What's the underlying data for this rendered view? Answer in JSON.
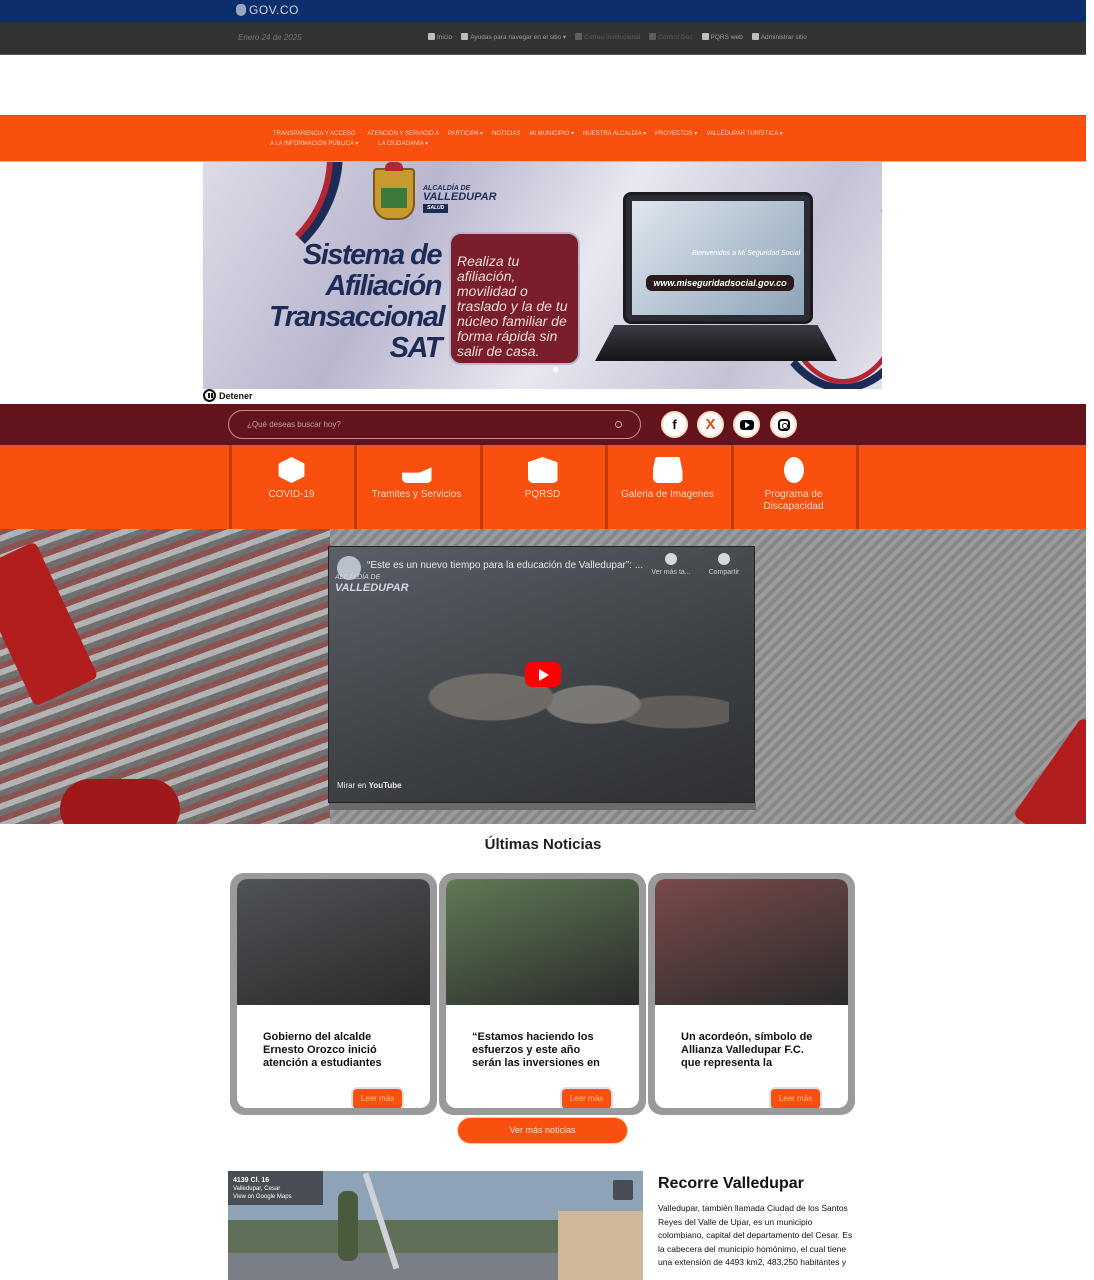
{
  "gov_bar": {
    "logo_text": "GOV.CO"
  },
  "utility_bar": {
    "date": "Enero 24 de 2025",
    "links": [
      {
        "label": "Inicio",
        "icon": "home-icon"
      },
      {
        "label": "Ayudas para navegar en el sitio ▾",
        "icon": "info-icon"
      },
      {
        "label": "Correo Institucional",
        "icon": "mail-icon"
      },
      {
        "label": "Control Doc",
        "icon": "folder-icon"
      },
      {
        "label": "PQRS web",
        "icon": "megaphone-icon"
      },
      {
        "label": "Administrar sitio",
        "icon": "gear-icon"
      }
    ]
  },
  "main_nav": {
    "items": [
      {
        "line1": "TRANSPARENCIA Y ACCESO",
        "line2": "A LA INFORMACIÓN PÚBLICA ▾"
      },
      {
        "line1": "ATENCIÓN Y SERVICIO A",
        "line2": "LA CIUDADANÍA ▾"
      },
      {
        "line1": "PARTICIPA ▾",
        "line2": ""
      },
      {
        "line1": "NOTICIAS",
        "line2": ""
      },
      {
        "line1": "MI MUNICIPIO ▾",
        "line2": ""
      },
      {
        "line1": "NUESTRA ALCALDÍA ▾",
        "line2": ""
      },
      {
        "line1": "PROYECTOS ▾",
        "line2": ""
      },
      {
        "line1": "VALLEDUPAR TURÍSTICA ▾",
        "line2": ""
      }
    ]
  },
  "banner": {
    "org_small": "ALCALDÍA DE",
    "org_big": "VALLEDUPAR",
    "org_tag": "SALUD",
    "title": "Sistema de Afiliación Transaccional SAT",
    "description": "Realiza tu afiliación, movilidad o traslado y la de tu núcleo familiar de forma rápida sin salir de casa.",
    "screen_greeting": "Bienvenidos a Mi Seguridad Social",
    "url": "www.miseguridadsocial.gov.co",
    "stop_label": "Detener"
  },
  "search": {
    "placeholder": "¿Qué deseas buscar hoy?"
  },
  "social": [
    {
      "name": "facebook",
      "glyph": "f"
    },
    {
      "name": "x",
      "glyph": "X"
    },
    {
      "name": "youtube",
      "glyph": ""
    },
    {
      "name": "instagram",
      "glyph": ""
    }
  ],
  "quick_links": [
    {
      "label": "COVID-19",
      "icon": "virus-icon"
    },
    {
      "label": "Tramites y Servicios",
      "icon": "hand-money-icon"
    },
    {
      "label": "PQRSD",
      "icon": "envelope-icon"
    },
    {
      "label": "Galeria de Imagenes",
      "icon": "inbox-icon"
    },
    {
      "label": "Programa de Discapacidad",
      "icon": "wheelchair-icon"
    }
  ],
  "video": {
    "title": "“Este es un nuevo tiempo para la educación de Valledupar”: ...",
    "watch_later": "Ver más ta...",
    "share": "Compartir",
    "channel_small": "ALCALDÍA DE",
    "channel_big": "VALLEDUPAR",
    "watch_on": "Mirar en",
    "platform": "YouTube"
  },
  "news": {
    "title": "Últimas Noticias",
    "items": [
      {
        "title": "Gobierno del alcalde Ernesto Orozco inició atención a estudiantes",
        "button": "Leer más",
        "image_color": "#4f5257"
      },
      {
        "title": "“Estamos haciendo los esfuerzos y este año serán las inversiones en",
        "button": "Leer más",
        "image_color": "#5f7a55"
      },
      {
        "title": "Un acordeón, símbolo de Allianza Valledupar F.C. que representa la",
        "button": "Leer más",
        "image_color": "#7a4a4a"
      }
    ],
    "more_button": "Ver más noticias"
  },
  "tour": {
    "map_address": "4139 Cl. 16",
    "map_city": "Valledupar, Cesar",
    "map_link": "View on Google Maps",
    "title": "Recorre Valledupar",
    "text": "Valledupar, también llamada Ciudad de los Santos Reyes del Valle de Upar, es un municipio colombiano, capital del departamento del Cesar. Es la cabecera del municipio homónimo, el cual tiene una extensión de 4493 km2, 483.250 habitantes y"
  }
}
